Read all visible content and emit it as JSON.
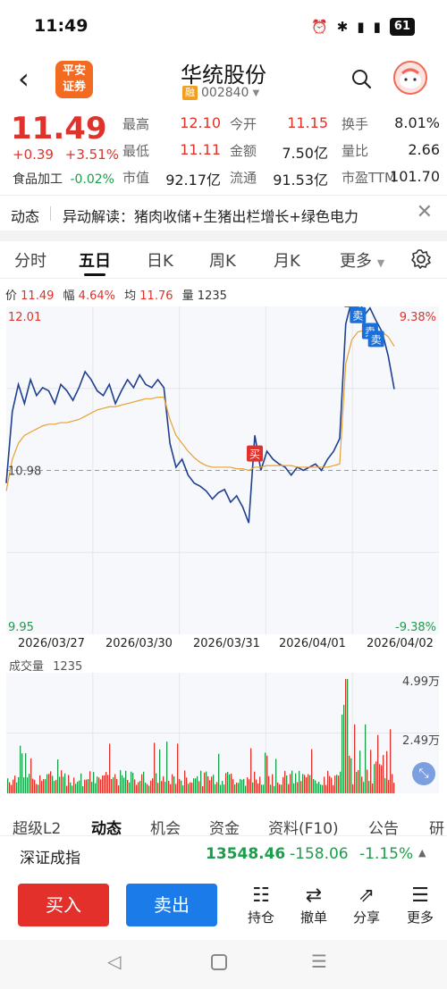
{
  "status_bar": {
    "time": "11:49",
    "icons": [
      "alarm-icon",
      "bluetooth-icon",
      "signal-icon",
      "4g-signal-icon"
    ],
    "battery": "61"
  },
  "header": {
    "logo_line1": "平安",
    "logo_line2": "证券",
    "stock_name": "华统股份",
    "badge": "融",
    "code": "002840"
  },
  "quote": {
    "price": "11.49",
    "change": "+0.39",
    "change_pct": "+3.51%",
    "sector": "食品加工",
    "sector_pct": "-0.02%",
    "rows": [
      [
        {
          "label": "最高",
          "value": "12.10",
          "color": "#e0312b"
        },
        {
          "label": "今开",
          "value": "11.15",
          "color": "#e0312b"
        },
        {
          "label": "换手",
          "value": "8.01%",
          "color": "#222222"
        }
      ],
      [
        {
          "label": "最低",
          "value": "11.11",
          "color": "#e0312b"
        },
        {
          "label": "金额",
          "value": "7.50亿",
          "color": "#222222"
        },
        {
          "label": "量比",
          "value": "2.66",
          "color": "#222222"
        }
      ],
      [
        {
          "label": "市值",
          "value": "92.17亿",
          "color": "#222222"
        },
        {
          "label": "流通",
          "value": "91.53亿",
          "color": "#222222"
        },
        {
          "label": "市盈TTM",
          "value": "101.70",
          "color": "#222222"
        }
      ]
    ]
  },
  "news": {
    "label": "动态",
    "text": "异动解读：猪肉收储+生猪出栏增长+绿色电力"
  },
  "tabs": [
    "分时",
    "五日",
    "日K",
    "周K",
    "月K",
    "更多"
  ],
  "active_tab": "五日",
  "info_line": {
    "price_label": "价",
    "price": "11.49",
    "range_label": "幅",
    "range": "4.64%",
    "avg_label": "均",
    "avg": "11.76",
    "vol_label": "量",
    "vol": "1235"
  },
  "chart_data": {
    "type": "line",
    "title": "",
    "x": [
      "2026/03/27",
      "2026/03/30",
      "2026/03/31",
      "2026/04/01",
      "2026/04/02"
    ],
    "ylim": [
      9.95,
      12.01
    ],
    "y_pct_labels": {
      "top": "9.38%",
      "bottom": "-9.38%"
    },
    "y_labels": {
      "top": "12.01",
      "bottom": "9.95",
      "prev_close": "10.98"
    },
    "series": [
      {
        "name": "价",
        "color": "#1f3f8f",
        "values": [
          10.9,
          11.35,
          11.52,
          11.4,
          11.55,
          11.45,
          11.5,
          11.48,
          11.4,
          11.52,
          11.48,
          11.42,
          11.5,
          11.6,
          11.55,
          11.48,
          11.45,
          11.52,
          11.4,
          11.48,
          11.55,
          11.5,
          11.58,
          11.52,
          11.5,
          11.55,
          11.5,
          11.15,
          11.0,
          11.05,
          10.95,
          10.9,
          10.88,
          10.85,
          10.8,
          10.84,
          10.86,
          10.78,
          10.82,
          10.75,
          10.65,
          11.2,
          10.98,
          11.1,
          11.05,
          11.02,
          11.0,
          10.95,
          11.0,
          10.98,
          11.0,
          11.02,
          10.98,
          11.05,
          11.1,
          11.18,
          11.9,
          12.05,
          12.1,
          11.95,
          12.0,
          11.92,
          11.85,
          11.7,
          11.49
        ]
      },
      {
        "name": "均",
        "color": "#e8a030",
        "values": [
          10.85,
          11.05,
          11.15,
          11.2,
          11.22,
          11.24,
          11.26,
          11.27,
          11.27,
          11.28,
          11.28,
          11.29,
          11.3,
          11.32,
          11.34,
          11.36,
          11.37,
          11.38,
          11.38,
          11.39,
          11.4,
          11.41,
          11.42,
          11.43,
          11.43,
          11.44,
          11.44,
          11.3,
          11.2,
          11.15,
          11.1,
          11.06,
          11.03,
          11.01,
          11.0,
          11.0,
          11.0,
          11.0,
          10.99,
          10.99,
          10.98,
          11.0,
          11.0,
          11.01,
          11.01,
          11.01,
          11.01,
          11.01,
          11.0,
          11.0,
          11.0,
          11.0,
          11.0,
          11.0,
          11.01,
          11.02,
          11.65,
          11.8,
          11.85,
          11.86,
          11.87,
          11.86,
          11.85,
          11.82,
          11.76
        ]
      }
    ],
    "trades": [
      {
        "label": "买",
        "color": "#e0312b",
        "index": 41,
        "value": 11.08
      },
      {
        "label": "卖",
        "color": "#1b6fd8",
        "index": 57,
        "value": 12.05
      },
      {
        "label": "卖",
        "color": "#1b6fd8",
        "index": 58,
        "value": 11.95
      },
      {
        "label": "卖",
        "color": "#1b6fd8",
        "index": 60,
        "value": 11.85
      },
      {
        "label": "卖",
        "color": "#1b6fd8",
        "index": 61,
        "value": 11.8
      }
    ],
    "volume": {
      "label": "成交量",
      "current": "1235",
      "tick_top": "4.99万",
      "tick_mid": "2.49万",
      "ylim": [
        0,
        49900
      ]
    }
  },
  "lower_tabs": [
    "超级L2",
    "动态",
    "机会",
    "资金",
    "资料(F10)",
    "公告",
    "研"
  ],
  "lower_active": "动态",
  "index_bar": {
    "name": "深证成指",
    "value": "13548.46",
    "change": "-158.06",
    "change_pct": "-1.15%"
  },
  "actions": {
    "buy": "买入",
    "sell": "卖出",
    "items": [
      {
        "icon": "position-icon",
        "label": "持仓"
      },
      {
        "icon": "withdraw-icon",
        "label": "撤单"
      },
      {
        "icon": "share-icon",
        "label": "分享"
      },
      {
        "icon": "more-icon",
        "label": "更多"
      }
    ]
  },
  "nav": [
    "back-nav-icon",
    "home-nav-icon",
    "recents-nav-icon"
  ]
}
